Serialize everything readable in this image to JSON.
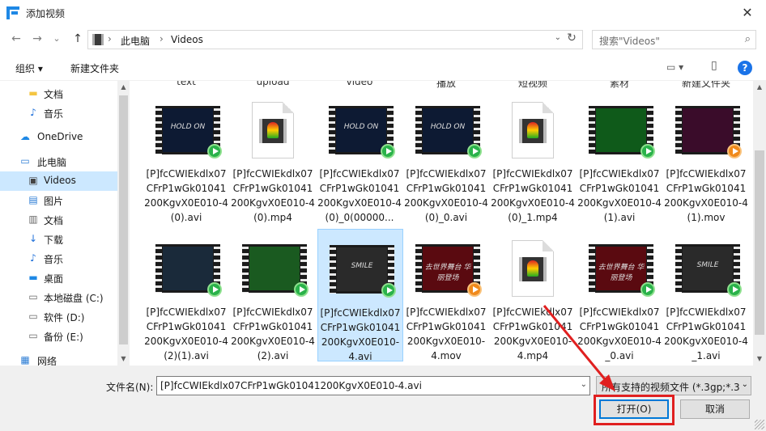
{
  "window": {
    "title": "添加视频",
    "close_glyph": "✕"
  },
  "nav_buttons": {
    "back": "←",
    "forward": "→",
    "recent": "⌄",
    "up": "↑"
  },
  "address": {
    "crumbs": [
      "此电脑",
      "Videos"
    ],
    "separator": "›",
    "dropdown": "⌄",
    "refresh": "↻"
  },
  "search": {
    "placeholder": "搜索\"Videos\"",
    "icon": "⌕"
  },
  "commands": {
    "organize": "组织 ▾",
    "new_folder": "新建文件夹",
    "view": "▭ ▾",
    "pane": "▯",
    "help": "?"
  },
  "nav_pane": {
    "items": [
      {
        "label": "文档",
        "icon": "folder-icon",
        "glyph": "▬",
        "color": "#f4c542",
        "root": false
      },
      {
        "label": "音乐",
        "icon": "music-icon",
        "glyph": "♪",
        "color": "#1e6fd9",
        "root": false
      },
      {
        "label": "OneDrive",
        "icon": "cloud-icon",
        "glyph": "☁",
        "color": "#1e88e5",
        "root": true
      },
      {
        "label": "此电脑",
        "icon": "computer-icon",
        "glyph": "▭",
        "color": "#2a7bd4",
        "root": true
      },
      {
        "label": "Videos",
        "icon": "videos-icon",
        "glyph": "▣",
        "color": "#444444",
        "root": false,
        "selected": true
      },
      {
        "label": "图片",
        "icon": "pictures-icon",
        "glyph": "▤",
        "color": "#2a7bd4",
        "root": false
      },
      {
        "label": "文档",
        "icon": "documents-icon",
        "glyph": "▥",
        "color": "#666666",
        "root": false
      },
      {
        "label": "下载",
        "icon": "download-icon",
        "glyph": "↓",
        "color": "#1e6fd9",
        "root": false
      },
      {
        "label": "音乐",
        "icon": "music-icon",
        "glyph": "♪",
        "color": "#1e6fd9",
        "root": false
      },
      {
        "label": "桌面",
        "icon": "desktop-icon",
        "glyph": "▬",
        "color": "#1e88e5",
        "root": false
      },
      {
        "label": "本地磁盘 (C:)",
        "icon": "drive-c-icon",
        "glyph": "▭",
        "color": "#666666",
        "root": false
      },
      {
        "label": "软件 (D:)",
        "icon": "drive-d-icon",
        "glyph": "▭",
        "color": "#666666",
        "root": false
      },
      {
        "label": "备份 (E:)",
        "icon": "drive-e-icon",
        "glyph": "▭",
        "color": "#666666",
        "root": false
      },
      {
        "label": "网络",
        "icon": "network-icon",
        "glyph": "▦",
        "color": "#2a7bd4",
        "root": true
      }
    ]
  },
  "folder_labels": [
    "text",
    "upload",
    "video",
    "播放",
    "短视频",
    "素材",
    "新建文件夹"
  ],
  "files": [
    {
      "name": "[P]fcCWIEkdlx07CFrP1wGk01041200KgvX0E010-4(0).avi",
      "kind": "video",
      "frame_color": "#0d1a33",
      "frame_text": "HOLD ON",
      "badge": "green"
    },
    {
      "name": "[P]fcCWIEkdlx07CFrP1wGk01041200KgvX0E010-4(0).mp4",
      "kind": "doc"
    },
    {
      "name": "[P]fcCWIEkdlx07CFrP1wGk01041200KgvX0E010-4(0)_0(00000...",
      "kind": "video",
      "frame_color": "#0d1a33",
      "frame_text": "HOLD ON",
      "badge": "green"
    },
    {
      "name": "[P]fcCWIEkdlx07CFrP1wGk01041200KgvX0E010-4(0)_0.avi",
      "kind": "video",
      "frame_color": "#0d1a33",
      "frame_text": "HOLD ON",
      "badge": "green"
    },
    {
      "name": "[P]fcCWIEkdlx07CFrP1wGk01041200KgvX0E010-4(0)_1.mp4",
      "kind": "doc"
    },
    {
      "name": "[P]fcCWIEkdlx07CFrP1wGk01041200KgvX0E010-4(1).avi",
      "kind": "video",
      "frame_color": "#0f5a1a",
      "frame_text": "",
      "badge": "green"
    },
    {
      "name": "[P]fcCWIEkdlx07CFrP1wGk01041200KgvX0E010-4(1).mov",
      "kind": "video",
      "frame_color": "#3a0c2a",
      "frame_text": "",
      "badge": "orange"
    },
    {
      "name": "[P]fcCWIEkdlx07CFrP1wGk01041200KgvX0E010-4(2)(1).avi",
      "kind": "video",
      "frame_color": "#1a2a3a",
      "frame_text": "",
      "badge": "green"
    },
    {
      "name": "[P]fcCWIEkdlx07CFrP1wGk01041200KgvX0E010-4(2).avi",
      "kind": "video",
      "frame_color": "#1a5a20",
      "frame_text": "",
      "badge": "green"
    },
    {
      "name": "[P]fcCWIEkdlx07CFrP1wGk01041200KgvX0E010-4.avi",
      "kind": "video",
      "frame_color": "#2a2a2a",
      "frame_text": "SMILE",
      "badge": "green",
      "selected": true
    },
    {
      "name": "[P]fcCWIEkdlx07CFrP1wGk01041200KgvX0E010-4.mov",
      "kind": "video",
      "frame_color": "#5a0a10",
      "frame_text": "去世界舞台 华丽登场",
      "badge": "orange"
    },
    {
      "name": "[P]fcCWIEkdlx07CFrP1wGk01041200KgvX0E010-4.mp4",
      "kind": "doc"
    },
    {
      "name": "[P]fcCWIEkdlx07CFrP1wGk01041200KgvX0E010-4_0.avi",
      "kind": "video",
      "frame_color": "#5a0a10",
      "frame_text": "去世界舞台 华丽登场",
      "badge": "green"
    },
    {
      "name": "[P]fcCWIEkdlx07CFrP1wGk01041200KgvX0E010-4_1.avi",
      "kind": "video",
      "frame_color": "#2a2a2a",
      "frame_text": "SMILE",
      "badge": "green"
    }
  ],
  "bottom": {
    "filename_label": "文件名(N):",
    "filename_value": "[P]fcCWIEkdlx07CFrP1wGk01041200KgvX0E010-4.avi",
    "dropdown": "⌄",
    "filetype_value": "所有支持的视频文件 (*.3gp;*.3",
    "open_label": "打开(O)",
    "cancel_label": "取消"
  },
  "colors": {
    "accent": "#0078d7",
    "selection": "#cce8ff",
    "annotation": "#e02020"
  }
}
